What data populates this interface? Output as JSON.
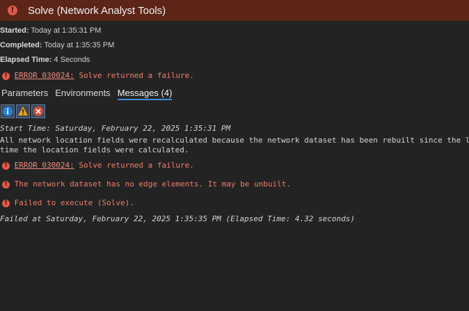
{
  "window": {
    "title": "Solve (Network Analyst Tools)"
  },
  "summary": {
    "started_label": "Started:",
    "started_value": "Today at 1:35:31 PM",
    "completed_label": "Completed:",
    "completed_value": "Today at 1:35:35 PM",
    "elapsed_label": "Elapsed Time:",
    "elapsed_value": "4 Seconds",
    "error_code": "ERROR 030024:",
    "error_text": " Solve returned a failure."
  },
  "tabs": [
    {
      "label": "Parameters"
    },
    {
      "label": "Environments"
    },
    {
      "label": "Messages (4)"
    }
  ],
  "filters": {
    "info_icon": "info-icon",
    "warning_icon": "warning-icon",
    "error_icon": "error-icon"
  },
  "messages": {
    "start_time": "Start Time: Saturday, February 22, 2025 1:35:31 PM",
    "recalc_line1": "All network location fields were recalculated because the network dataset has been rebuilt since the la",
    "recalc_line2": "time the location fields were calculated.",
    "error1_code": "ERROR 030024:",
    "error1_text": " Solve returned a failure.",
    "error2_text": "The network dataset has no edge elements. It may be unbuilt.",
    "error3_text": "Failed to execute (Solve).",
    "failed_at": "Failed at Saturday, February 22, 2025 1:35:35 PM (Elapsed Time: 4.32 seconds)"
  },
  "colors": {
    "title_bar": "#5c2518",
    "background": "#232323",
    "error_text": "#f07d6a",
    "active_tab_underline": "#3d8ee0"
  }
}
